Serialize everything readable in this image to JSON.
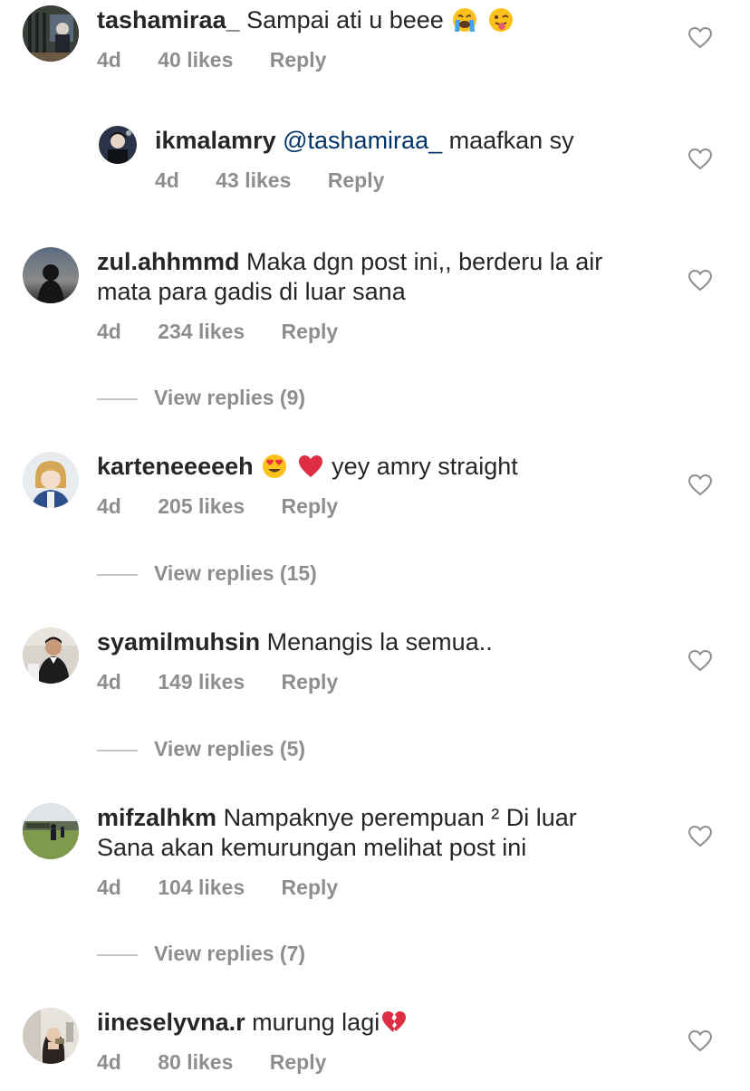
{
  "comments": [
    {
      "username": "tashamiraa_",
      "text": "Sampai ati u beee",
      "emojis": [
        "crying-face",
        "winking-face-with-tongue"
      ],
      "age": "4d",
      "likes": "40 likes",
      "reply": "Reply"
    },
    {
      "username": "ikmalamry",
      "mention": "@tashamiraa_",
      "text": "maafkan sy",
      "age": "4d",
      "likes": "43 likes",
      "reply": "Reply"
    },
    {
      "username": "zul.ahhmmd",
      "text": "Maka dgn post ini,, berderu la air mata para gadis di luar sana",
      "age": "4d",
      "likes": "234 likes",
      "reply": "Reply",
      "view_replies": "View replies (9)"
    },
    {
      "username": "karteneeeeeh",
      "emojis": [
        "heart-eyes-face",
        "red-heart"
      ],
      "text": "yey amry straight",
      "age": "4d",
      "likes": "205 likes",
      "reply": "Reply",
      "view_replies": "View replies (15)"
    },
    {
      "username": "syamilmuhsin",
      "text": "Menangis la semua..",
      "age": "4d",
      "likes": "149 likes",
      "reply": "Reply",
      "view_replies": "View replies (5)"
    },
    {
      "username": "mifzalhkm",
      "text": "Nampaknye perempuan ² Di luar Sana akan kemurungan melihat post ini",
      "age": "4d",
      "likes": "104 likes",
      "reply": "Reply",
      "view_replies": "View replies (7)"
    },
    {
      "username": "iineselyvna.r",
      "text": "murung lagi",
      "emojis": [
        "broken-heart"
      ],
      "age": "4d",
      "likes": "80 likes",
      "reply": "Reply"
    }
  ],
  "colors": {
    "text": "#262626",
    "secondary": "#8e8e8e",
    "mention": "#003569"
  }
}
